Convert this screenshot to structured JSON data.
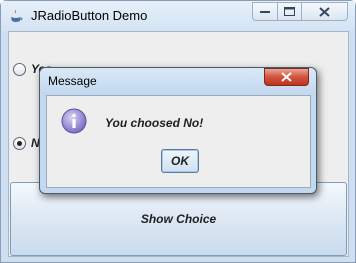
{
  "main_window": {
    "title": "JRadioButton Demo",
    "icon": "java-icon",
    "controls": {
      "minimize": "minimize-icon",
      "maximize": "maximize-icon",
      "close": "close-icon"
    }
  },
  "radio_buttons": [
    {
      "label": "Yes",
      "selected": false
    },
    {
      "label": "No",
      "selected": true
    }
  ],
  "show_choice_button": {
    "label": "Show Choice"
  },
  "dialog": {
    "title": "Message",
    "icon": "info-icon",
    "message": "You choosed No!",
    "ok_label": "OK",
    "close_icon": "close-icon"
  },
  "colors": {
    "dialog_close": "#c9402b",
    "info_icon": "#7b6fc4",
    "window_frame": "#cddff0"
  }
}
